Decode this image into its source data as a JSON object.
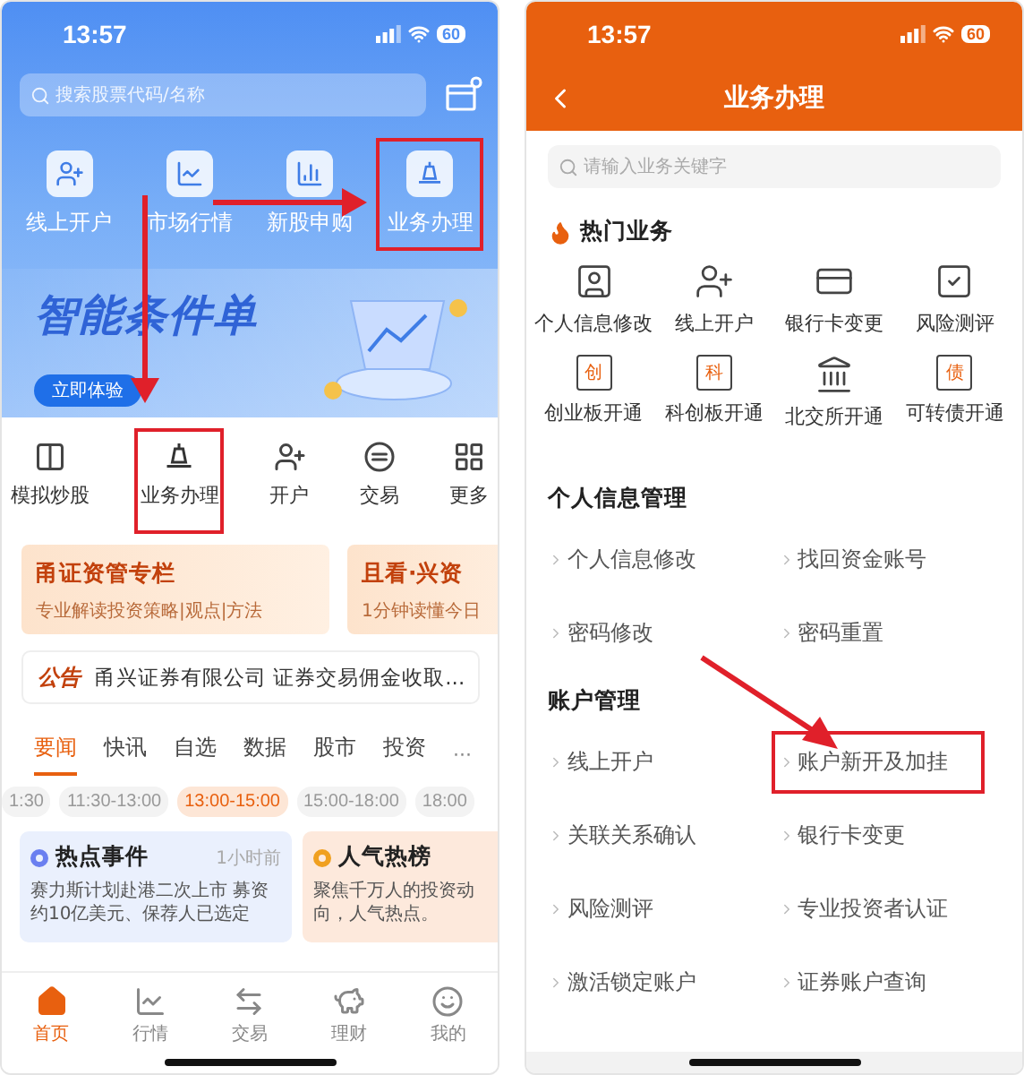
{
  "left_screen": {
    "status_bar": {
      "time": "13:57",
      "battery": "60"
    },
    "search": {
      "placeholder": "搜索股票代码/名称"
    },
    "quick_actions": [
      {
        "label": "线上开户",
        "highlighted": false
      },
      {
        "label": "市场行情",
        "highlighted": false
      },
      {
        "label": "新股申购",
        "highlighted": false
      },
      {
        "label": "业务办理",
        "highlighted": true
      }
    ],
    "banner": {
      "title": "智能条件单",
      "button": "立即体验"
    },
    "menu": [
      {
        "label": "模拟炒股",
        "highlighted": false
      },
      {
        "label": "业务办理",
        "highlighted": true
      },
      {
        "label": "开户",
        "highlighted": false
      },
      {
        "label": "交易",
        "highlighted": false
      },
      {
        "label": "更多",
        "highlighted": false
      }
    ],
    "promo_cards": [
      {
        "title": "甬证资管专栏",
        "subtitle": "专业解读投资策略|观点|方法"
      },
      {
        "title": "且看·兴资",
        "subtitle": "1分钟读懂今日"
      }
    ],
    "notice": {
      "tag": "公告",
      "text": "甬兴证券有限公司 证券交易佣金收取..."
    },
    "news_tabs": [
      {
        "label": "要闻",
        "selected": true
      },
      {
        "label": "快讯",
        "selected": false
      },
      {
        "label": "自选",
        "selected": false
      },
      {
        "label": "数据",
        "selected": false
      },
      {
        "label": "股市",
        "selected": false
      },
      {
        "label": "投资",
        "selected": false
      }
    ],
    "news_more": "···",
    "time_slots": [
      {
        "label": "1:30",
        "selected": false
      },
      {
        "label": "11:30-13:00",
        "selected": false
      },
      {
        "label": "13:00-15:00",
        "selected": true
      },
      {
        "label": "15:00-18:00",
        "selected": false
      },
      {
        "label": "18:00",
        "selected": false
      }
    ],
    "news_cards": [
      {
        "title": "热点事件",
        "time": "1小时前",
        "text": "赛力斯计划赴港二次上市 募资约10亿美元、保荐人已选定",
        "color": "#6a7ff0"
      },
      {
        "title": "人气热榜",
        "text": "聚焦千万人的投资动向，人气热点。",
        "color": "#f0a020"
      }
    ],
    "bottom_nav": [
      {
        "label": "首页",
        "selected": true
      },
      {
        "label": "行情",
        "selected": false
      },
      {
        "label": "交易",
        "selected": false
      },
      {
        "label": "理财",
        "selected": false
      },
      {
        "label": "我的",
        "selected": false
      }
    ]
  },
  "right_screen": {
    "status_bar": {
      "time": "13:57",
      "battery": "60"
    },
    "title": "业务办理",
    "search": {
      "placeholder": "请输入业务关键字"
    },
    "hot_title": "热门业务",
    "hot_items": [
      {
        "label": "个人信息修改"
      },
      {
        "label": "线上开户"
      },
      {
        "label": "银行卡变更"
      },
      {
        "label": "风险测评"
      },
      {
        "label": "创业板开通",
        "glyph": "创"
      },
      {
        "label": "科创板开通",
        "glyph": "科"
      },
      {
        "label": "北交所开通"
      },
      {
        "label": "可转债开通",
        "glyph": "债"
      }
    ],
    "sections": [
      {
        "title": "个人信息管理",
        "items": [
          {
            "label": "个人信息修改",
            "highlighted": false
          },
          {
            "label": "找回资金账号",
            "highlighted": false
          },
          {
            "label": "密码修改",
            "highlighted": false
          },
          {
            "label": "密码重置",
            "highlighted": false
          }
        ]
      },
      {
        "title": "账户管理",
        "items": [
          {
            "label": "线上开户",
            "highlighted": false
          },
          {
            "label": "账户新开及加挂",
            "highlighted": true
          },
          {
            "label": "关联关系确认",
            "highlighted": false
          },
          {
            "label": "银行卡变更",
            "highlighted": false
          },
          {
            "label": "风险测评",
            "highlighted": false
          },
          {
            "label": "专业投资者认证",
            "highlighted": false
          },
          {
            "label": "激活锁定账户",
            "highlighted": false
          },
          {
            "label": "证券账户查询",
            "highlighted": false
          }
        ]
      }
    ]
  }
}
